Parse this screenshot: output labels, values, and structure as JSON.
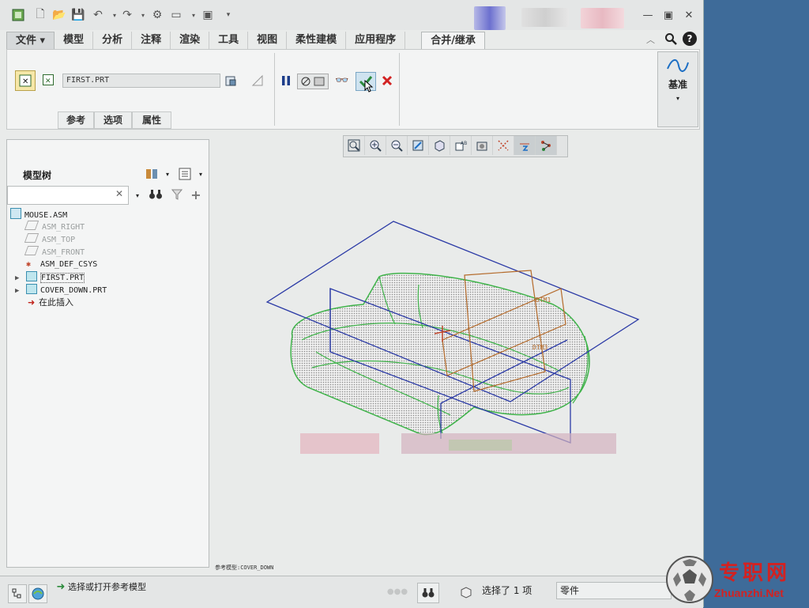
{
  "ribbon": {
    "tabs": [
      "文件 ▾",
      "模型",
      "分析",
      "注释",
      "渲染",
      "工具",
      "视图",
      "柔性建模",
      "应用程序"
    ],
    "active_tab": "合并/继承",
    "reference_model": "FIRST.PRT",
    "subtabs": [
      "参考",
      "选项",
      "属性"
    ],
    "datum_label": "基准"
  },
  "model_tree": {
    "title": "模型树",
    "items": [
      {
        "label": "MOUSE.ASM",
        "icon": "assembly-icon"
      },
      {
        "label": "ASM_RIGHT",
        "icon": "datum-plane-icon"
      },
      {
        "label": "ASM_TOP",
        "icon": "datum-plane-icon"
      },
      {
        "label": "ASM_FRONT",
        "icon": "datum-plane-icon"
      },
      {
        "label": "ASM_DEF_CSYS",
        "icon": "csys-icon"
      },
      {
        "label": "FIRST.PRT",
        "icon": "part-icon"
      },
      {
        "label": "COVER_DOWN.PRT",
        "icon": "part-icon"
      },
      {
        "label": "在此插入",
        "icon": "insert-arrow-icon"
      }
    ]
  },
  "graphics": {
    "datum_labels": [
      "DTM1",
      "DTM3"
    ],
    "bottom_label": "参考模型:COVER_DOWN"
  },
  "status": {
    "message": "选择或打开参考模型",
    "selection": "选择了 1 项",
    "filter": "零件"
  },
  "watermark": {
    "cn": "专职网",
    "en": "Zhuanzhi.Net"
  },
  "colors": {
    "desktop": "#3e6b99",
    "accent_check": "#2c8a3c",
    "cancel": "#d22222",
    "wire_green": "#3fb34a",
    "wire_blue": "#2b3aa6",
    "datum_brown": "#b46a2a"
  }
}
